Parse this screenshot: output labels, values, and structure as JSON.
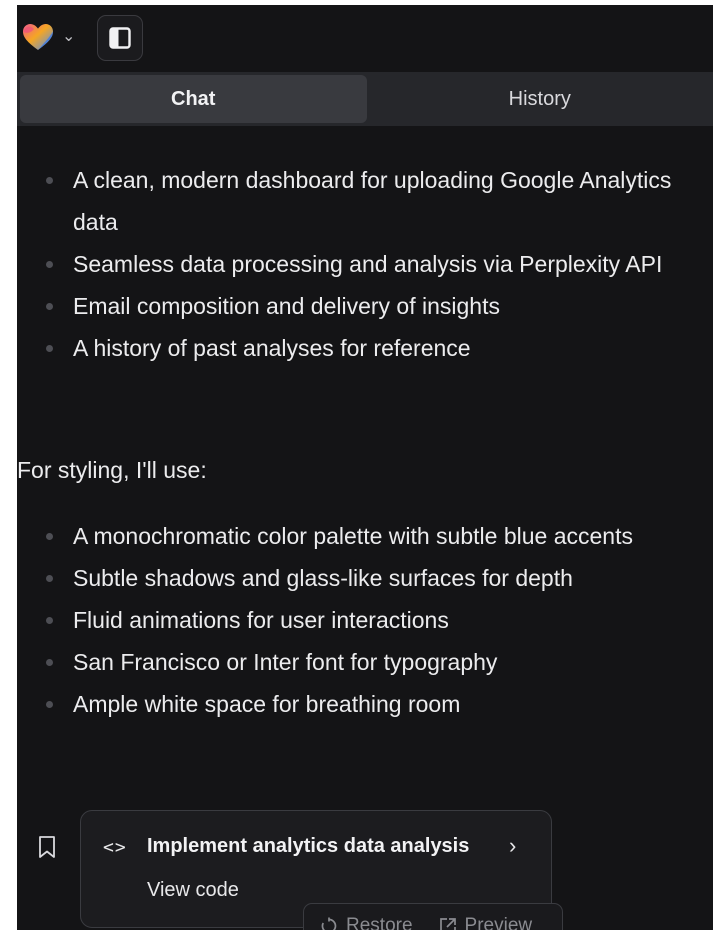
{
  "window": {
    "logo_icon": "heart-logo-icon",
    "logo_menu_icon": "chevron-down-icon",
    "sidebar_toggle_icon": "sidebar-toggle-icon"
  },
  "tabs": [
    {
      "label": "Chat",
      "active": true
    },
    {
      "label": "History",
      "active": false
    }
  ],
  "message": {
    "features": [
      "A clean, modern dashboard for uploading Google Analytics data",
      "Seamless data processing and analysis via Perplexity API",
      "Email composition and delivery of insights",
      "A history of past analyses for reference"
    ],
    "styling_intro": "For styling, I'll use:",
    "styling": [
      "A monochromatic color palette with subtle blue accents",
      "Subtle shadows and glass-like surfaces for depth",
      "Fluid animations for user interactions",
      "San Francisco or Inter font for typography",
      "Ample white space for breathing room"
    ]
  },
  "card": {
    "icon": "code-icon",
    "title": "Implement analytics data analysis",
    "subtitle": "View code",
    "chevron_icon": "chevron-right-icon"
  },
  "actions": {
    "restore_label": "Restore",
    "preview_label": "Preview"
  },
  "colors": {
    "background": "#141416",
    "tab_bar": "#26272b",
    "tab_active": "#393a3f",
    "text": "#ececee",
    "muted": "#8a8b90"
  }
}
